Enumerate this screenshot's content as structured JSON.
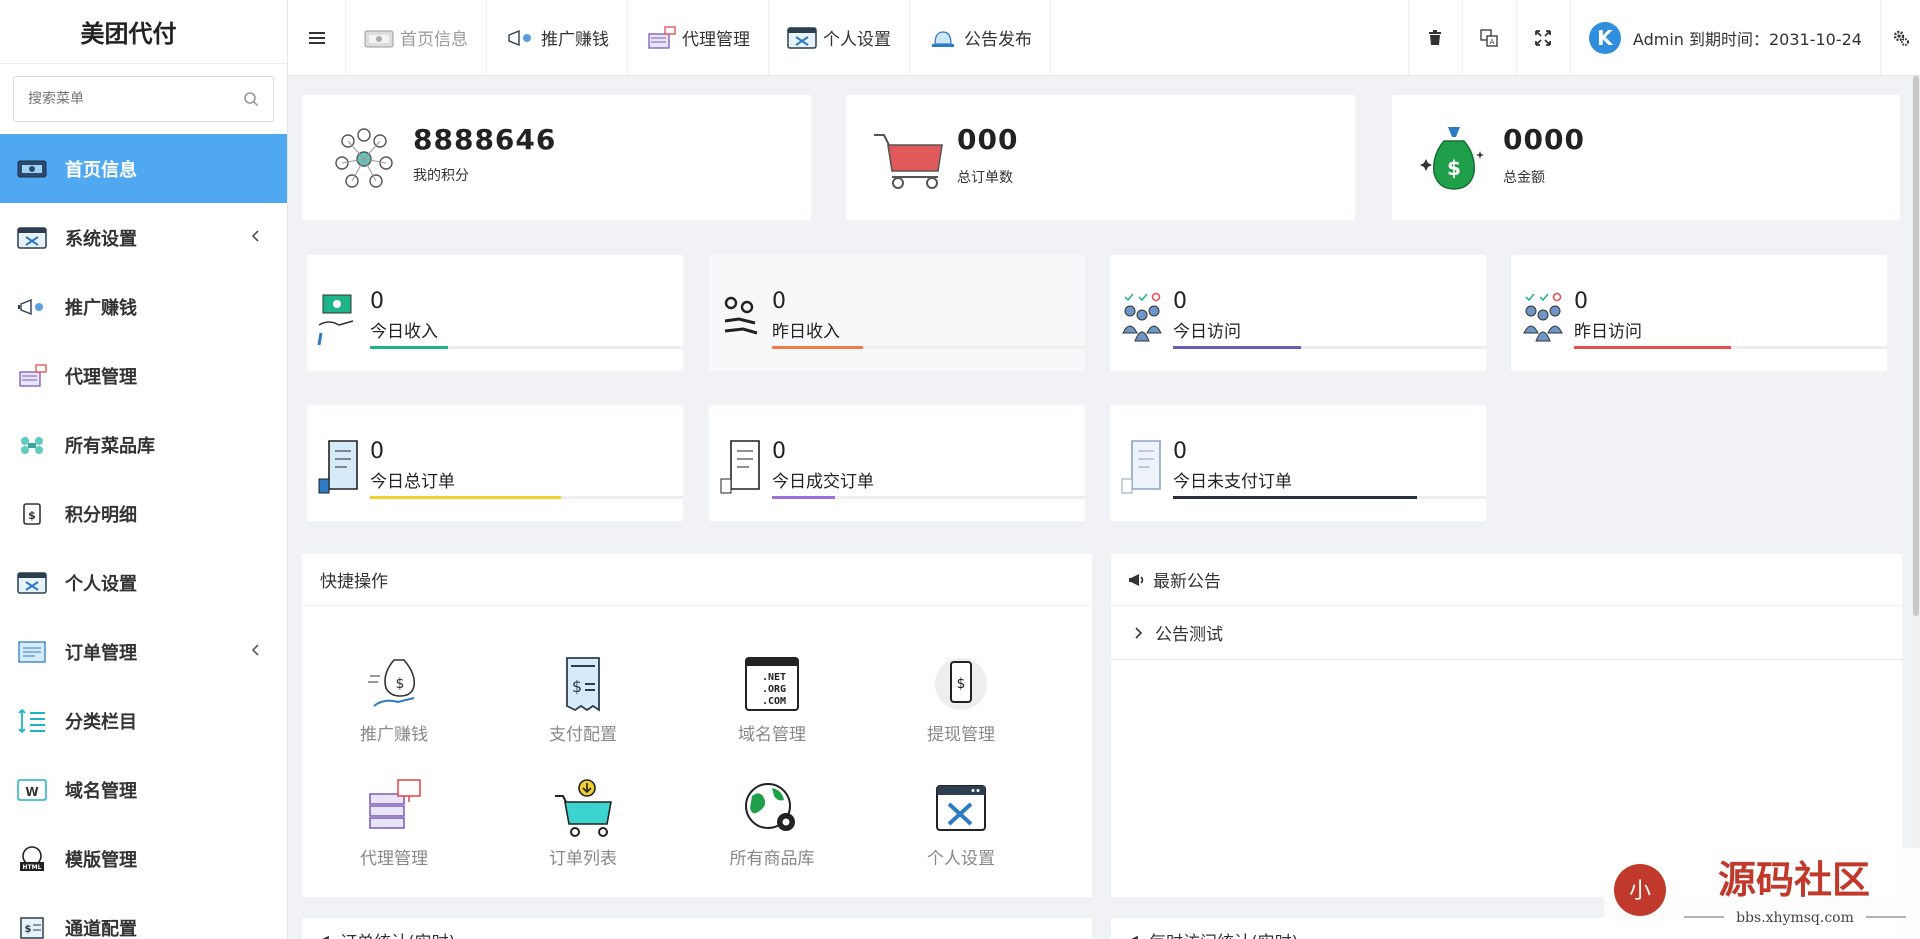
{
  "app": {
    "title": "美团代付"
  },
  "sidebar": {
    "search_placeholder": "搜索菜单",
    "items": [
      {
        "label": "首页信息",
        "icon": "dashboard-icon",
        "active": true
      },
      {
        "label": "系统设置",
        "icon": "system-settings-icon",
        "has_submenu": true
      },
      {
        "label": "推广赚钱",
        "icon": "megaphone-icon"
      },
      {
        "label": "代理管理",
        "icon": "agent-icon"
      },
      {
        "label": "所有菜品库",
        "icon": "dish-library-icon"
      },
      {
        "label": "积分明细",
        "icon": "points-icon"
      },
      {
        "label": "个人设置",
        "icon": "personal-settings-icon"
      },
      {
        "label": "订单管理",
        "icon": "order-icon",
        "has_submenu": true
      },
      {
        "label": "分类栏目",
        "icon": "category-icon"
      },
      {
        "label": "域名管理",
        "icon": "domain-icon"
      },
      {
        "label": "模版管理",
        "icon": "template-icon"
      },
      {
        "label": "通道配置",
        "icon": "channel-icon"
      }
    ]
  },
  "topbar": {
    "tabs": [
      {
        "label": "首页信息",
        "icon": "dashboard-icon",
        "active": true
      },
      {
        "label": "推广赚钱",
        "icon": "megaphone-icon"
      },
      {
        "label": "代理管理",
        "icon": "agent-icon"
      },
      {
        "label": "个人设置",
        "icon": "personal-settings-icon"
      },
      {
        "label": "公告发布",
        "icon": "bell-icon"
      }
    ],
    "user_text": "Admin 到期时间：2031-10-24",
    "avatar_letter": "K"
  },
  "stats_big": [
    {
      "value": "8888646",
      "label": "我的积分",
      "icon": "network-people-icon"
    },
    {
      "value": "000",
      "label": "总订单数",
      "icon": "shopping-cart-icon"
    },
    {
      "value": "0000",
      "label": "总金额",
      "icon": "money-bag-icon"
    }
  ],
  "stats_small": [
    {
      "value": "0",
      "label": "今日收入",
      "icon": "income-icon",
      "color": "#1fb38a",
      "progress": 0.25
    },
    {
      "value": "0",
      "label": "昨日收入",
      "icon": "coins-icon",
      "color": "#f07b47",
      "progress": 0.29
    },
    {
      "value": "0",
      "label": "今日访问",
      "icon": "visitors-icon",
      "color": "#6b5bb8",
      "progress": 0.41
    },
    {
      "value": "0",
      "label": "昨日访问",
      "icon": "visitors-icon",
      "color": "#e84c4c",
      "progress": 0.5
    },
    {
      "value": "0",
      "label": "今日总订单",
      "icon": "order-doc-icon",
      "color": "#f2cf2e",
      "progress": 0.61
    },
    {
      "value": "0",
      "label": "今日成交订单",
      "icon": "order-doc-icon",
      "color": "#9b6fd6",
      "progress": 0.2
    },
    {
      "value": "0",
      "label": "今日未支付订单",
      "icon": "order-doc-icon",
      "color": "#2b3142",
      "progress": 0.78
    }
  ],
  "quick_actions": {
    "title": "快捷操作",
    "items": [
      {
        "label": "推广赚钱",
        "icon": "money-hand-icon"
      },
      {
        "label": "支付配置",
        "icon": "receipt-icon"
      },
      {
        "label": "域名管理",
        "icon": "domain-list-icon"
      },
      {
        "label": "提现管理",
        "icon": "phone-dollar-icon"
      },
      {
        "label": "代理管理",
        "icon": "server-icon"
      },
      {
        "label": "订单列表",
        "icon": "cart-download-icon"
      },
      {
        "label": "所有商品库",
        "icon": "globe-gear-icon"
      },
      {
        "label": "个人设置",
        "icon": "browser-tools-icon"
      }
    ]
  },
  "notice": {
    "title": "最新公告",
    "items": [
      {
        "label": "公告测试"
      }
    ]
  },
  "bottom_panels": [
    "订单统计(实时)",
    "每时访问统计(实时)"
  ],
  "watermark": {
    "title": "源码社区",
    "url": "bbs.xhymsq.com"
  }
}
